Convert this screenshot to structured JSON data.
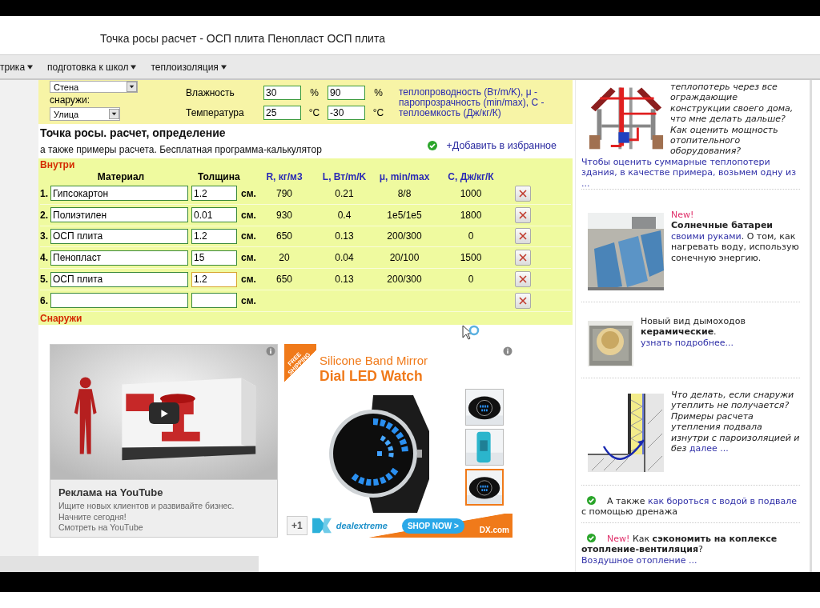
{
  "browser": {
    "title": "Точка росы расчет - ОСП плита Пенопласт ОСП плита"
  },
  "nav": [
    {
      "label": "трика"
    },
    {
      "label": "подготовка к школ"
    },
    {
      "label": "теплоизоляция"
    }
  ],
  "conditions": {
    "inside_select": "Стена",
    "outside_label": "снаружи:",
    "outside_select": "Улица",
    "rows": [
      {
        "label": "Влажность",
        "inside": "30",
        "inside_unit": "%",
        "outside": "90",
        "outside_unit": "%"
      },
      {
        "label": "Температура",
        "inside": "25",
        "inside_unit": "°C",
        "outside": "-30",
        "outside_unit": "°C"
      }
    ],
    "legend": "теплопроводность (Вт/m/K), μ - паропрозрачность (min/max), С - теплоемкость (Дж/кг/К)"
  },
  "heading": "Точка росы. расчет, определение",
  "subtitle": "а также примеры расчета. Бесплатная программа-калькулятор",
  "favorite": "+Добавить в избранное",
  "calculator": {
    "inside_label": "Внутри",
    "outside_label": "Снаружи",
    "columns": [
      "Материал",
      "Толщина",
      "R, кг/м3",
      "L, Вт/m/K",
      "μ, min/max",
      "С, Дж/кг/К"
    ],
    "rows": [
      {
        "number": "1.",
        "material": "Гипсокартон",
        "thickness": "1.2",
        "unit": "см.",
        "r": "790",
        "l": "0.21",
        "mu": "8/8",
        "c": "1000",
        "focused": false
      },
      {
        "number": "2.",
        "material": "Полиэтилен",
        "thickness": "0.01",
        "unit": "см.",
        "r": "930",
        "l": "0.4",
        "mu": "1e5/1e5",
        "c": "1800",
        "focused": false
      },
      {
        "number": "3.",
        "material": "ОСП плита",
        "thickness": "1.2",
        "unit": "см.",
        "r": "650",
        "l": "0.13",
        "mu": "200/300",
        "c": "0",
        "focused": false
      },
      {
        "number": "4.",
        "material": "Пенопласт",
        "thickness": "15",
        "unit": "см.",
        "r": "20",
        "l": "0.04",
        "mu": "20/100",
        "c": "1500",
        "focused": false
      },
      {
        "number": "5.",
        "material": "ОСП плита",
        "thickness": "1.2",
        "unit": "см.",
        "r": "650",
        "l": "0.13",
        "mu": "200/300",
        "c": "0",
        "focused": true
      },
      {
        "number": "6.",
        "unit": "см.",
        "focused": false
      }
    ]
  },
  "youtube_ad": {
    "title": "Реклама на YouTube",
    "lines": [
      "Ищите новых клиентов и развивайте бизнес.",
      "Начните сегодня!"
    ],
    "link": "Смотреть на YouTube"
  },
  "watch_ad": {
    "ribbon": "FREE SHIPPING",
    "title": "Silicone Band Mirror",
    "subtitle": "Dial LED Watch",
    "plus_one": "+1",
    "brand": "dealextreme",
    "button": "SHOP NOW >",
    "site": "DX.com",
    "thumbnails": [
      {
        "selected": false
      },
      {
        "selected": false
      },
      {
        "selected": true
      }
    ]
  },
  "sidebar": [
    {
      "kind": "house",
      "text": "теплопотерь через все ограждающие конструкции своего дома, что мне делать дальше? Как оценить мощность отопительного оборудования?",
      "link": "Чтобы оценить суммарные теплопотери здания, в качестве примера, возьмем одну из ..."
    },
    {
      "kind": "solar",
      "badge": "New!",
      "title": "Солнечные батареи",
      "link": "своими руками",
      "text": ". О том, как нагревать воду, использую сонечную энергию."
    },
    {
      "kind": "chimney",
      "text": "Новый вид дымоходов **керамические**.",
      "link": "узнать подробнее..."
    },
    {
      "kind": "basement",
      "text": "Что делать, если снаружи утеплить не получается? Примеры расчета утепления подвала изнутри с пароизоляцией и без",
      "link": "далее ..."
    },
    {
      "kind": "drainage",
      "text": "А также",
      "link": "как бороться с водой в подвале",
      "text_after": "с помощью дренажа"
    },
    {
      "kind": "ventilation",
      "badge": "New!",
      "text": "Как **сэкономить на коплексе отопление-вентиляция**?",
      "link": "Воздушное отопление ..."
    }
  ]
}
